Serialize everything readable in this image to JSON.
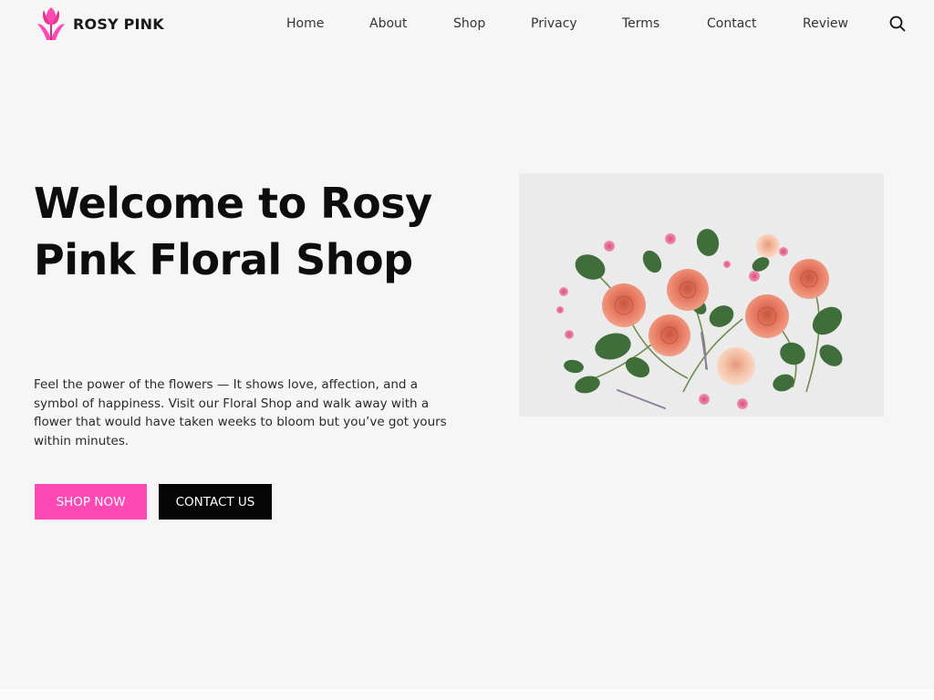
{
  "brand": {
    "name": "ROSY PINK",
    "logo_icon": "tulip-icon",
    "accent_color": "#fc49b4"
  },
  "nav": {
    "items": [
      {
        "label": "Home"
      },
      {
        "label": "About"
      },
      {
        "label": "Shop"
      },
      {
        "label": "Privacy"
      },
      {
        "label": "Terms"
      },
      {
        "label": "Contact"
      },
      {
        "label": "Review"
      }
    ],
    "search_icon": "search-icon"
  },
  "hero": {
    "title": "Welcome to Rosy Pink Floral Shop",
    "description": "Feel the power of the flowers — It shows love, affection, and a symbol of happiness. Visit our Floral Shop and walk away with a flower that would have taken weeks to bloom but you’ve got yours within minutes.",
    "primary_button": "SHOP NOW",
    "secondary_button": "CONTACT US",
    "primary_color": "#fc49b4",
    "secondary_color": "#050505",
    "image": "roses-flatlay-image"
  }
}
